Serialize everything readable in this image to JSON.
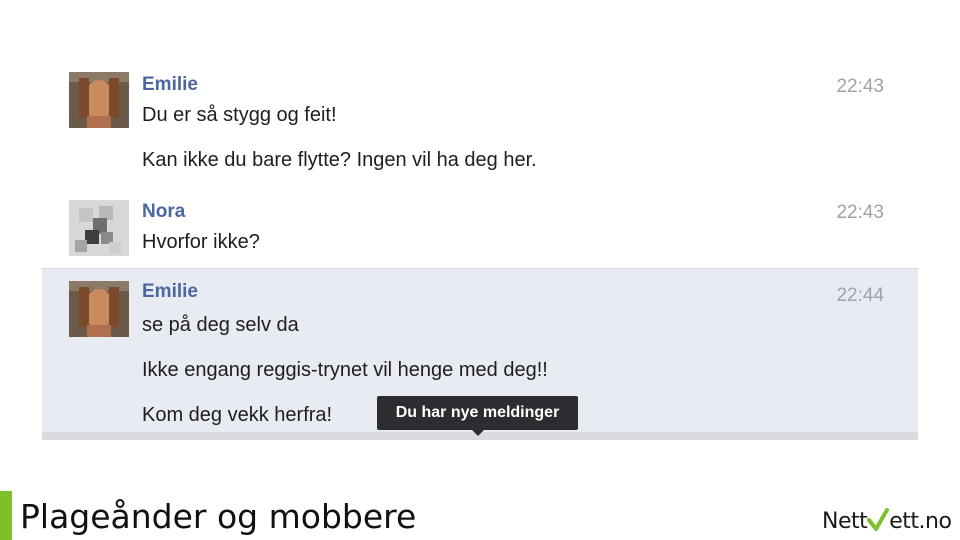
{
  "chat": {
    "messages": [
      {
        "sender": "Emilie",
        "time": "22:43",
        "lines": [
          "Du er så stygg og feit!",
          "Kan ikke du bare flytte? Ingen vil ha deg her."
        ],
        "avatar": "portrait-avatar"
      },
      {
        "sender": "Nora",
        "time": "22:43",
        "lines": [
          "Hvorfor ikke?"
        ],
        "avatar": "blurred-avatar"
      },
      {
        "sender": "Emilie",
        "time": "22:44",
        "lines": [
          "se på deg selv da",
          "Ikke engang reggis-trynet vil henge med deg!!",
          "Kom deg vekk herfra!"
        ],
        "avatar": "portrait-avatar"
      }
    ],
    "tooltip": "Du har nye meldinger"
  },
  "slide": {
    "title": "Plageånder og mobbere",
    "logo_left": "Nett",
    "logo_right": "ett.no",
    "accent_color": "#7cc02a"
  },
  "colors": {
    "sender": "#4b67a1",
    "highlight": "#e9ebf2"
  }
}
